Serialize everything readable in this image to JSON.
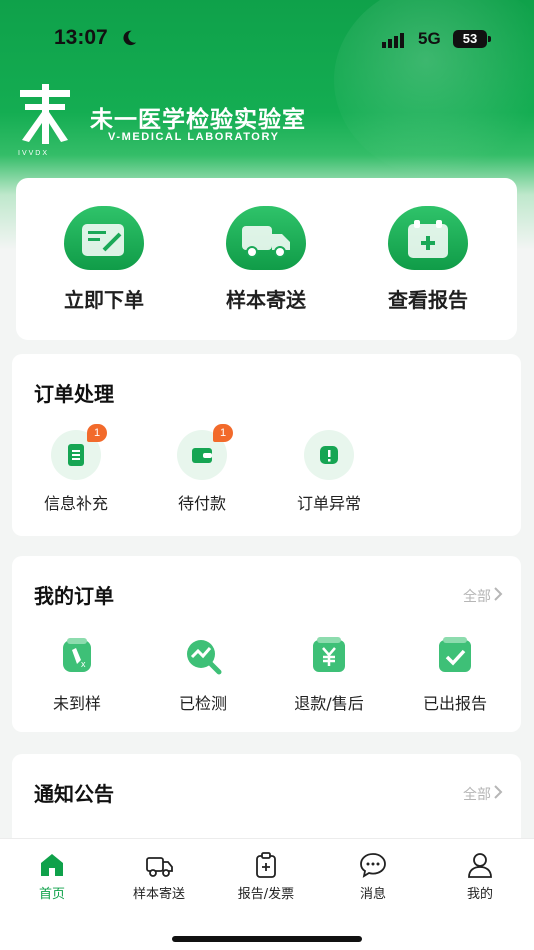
{
  "status_bar": {
    "time": "13:07",
    "network": "5G",
    "battery": "53"
  },
  "brand": {
    "name_cn": "未一医学检验实验室",
    "name_en": "V-MEDICAL LABORATORY",
    "logo_sub": "IVVDX"
  },
  "quick_actions": [
    {
      "label": "立即下单",
      "icon": "order-edit-icon"
    },
    {
      "label": "样本寄送",
      "icon": "truck-icon"
    },
    {
      "label": "查看报告",
      "icon": "report-icon"
    }
  ],
  "order_processing": {
    "title": "订单处理",
    "items": [
      {
        "label": "信息补充",
        "badge": "1",
        "icon": "info-doc-icon"
      },
      {
        "label": "待付款",
        "badge": "1",
        "icon": "wallet-icon"
      },
      {
        "label": "订单异常",
        "badge": "",
        "icon": "alert-icon"
      }
    ]
  },
  "my_orders": {
    "title": "我的订单",
    "more": "全部",
    "items": [
      {
        "label": "未到样",
        "icon": "tube-cancel-icon"
      },
      {
        "label": "已检测",
        "icon": "chart-search-icon"
      },
      {
        "label": "退款/售后",
        "icon": "refund-icon"
      },
      {
        "label": "已出报告",
        "icon": "check-report-icon"
      }
    ]
  },
  "notice": {
    "title": "通知公告",
    "more": "全部"
  },
  "tabbar": [
    {
      "label": "首页",
      "icon": "home-icon",
      "active": true
    },
    {
      "label": "样本寄送",
      "icon": "truck-icon",
      "active": false
    },
    {
      "label": "报告/发票",
      "icon": "clipboard-icon",
      "active": false
    },
    {
      "label": "消息",
      "icon": "message-icon",
      "active": false
    },
    {
      "label": "我的",
      "icon": "user-icon",
      "active": false
    }
  ],
  "colors": {
    "primary": "#0fa14a",
    "badge": "#f26a2b",
    "light_green": "#e8f6ed"
  }
}
